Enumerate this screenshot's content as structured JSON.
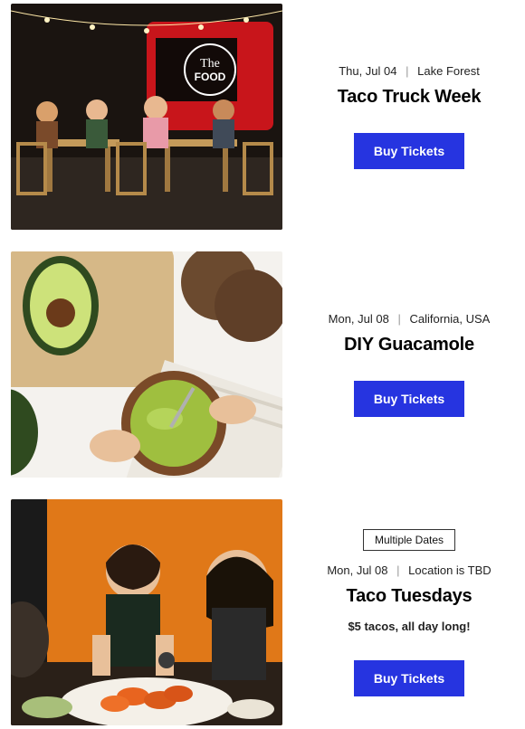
{
  "buttons": {
    "buy_label": "Buy Tickets"
  },
  "events": [
    {
      "badge": null,
      "date": "Thu, Jul 04",
      "location": "Lake Forest",
      "title": "Taco Truck Week",
      "subtitle": null,
      "image_alt": "People dining outdoors at tables near a red food truck labeled The Food Stop"
    },
    {
      "badge": null,
      "date": "Mon, Jul 08",
      "location": "California, USA",
      "title": "DIY Guacamole",
      "subtitle": null,
      "image_alt": "Top-down view of hands mashing guacamole in a bowl with avocados and bread on a cutting board"
    },
    {
      "badge": "Multiple Dates",
      "date": "Mon, Jul 08",
      "location": "Location is TBD",
      "title": "Taco Tuesdays",
      "subtitle": "$5 tacos, all day long!",
      "image_alt": "Friends at a table with a large plate of shrimp tacos, orange wall background"
    }
  ]
}
